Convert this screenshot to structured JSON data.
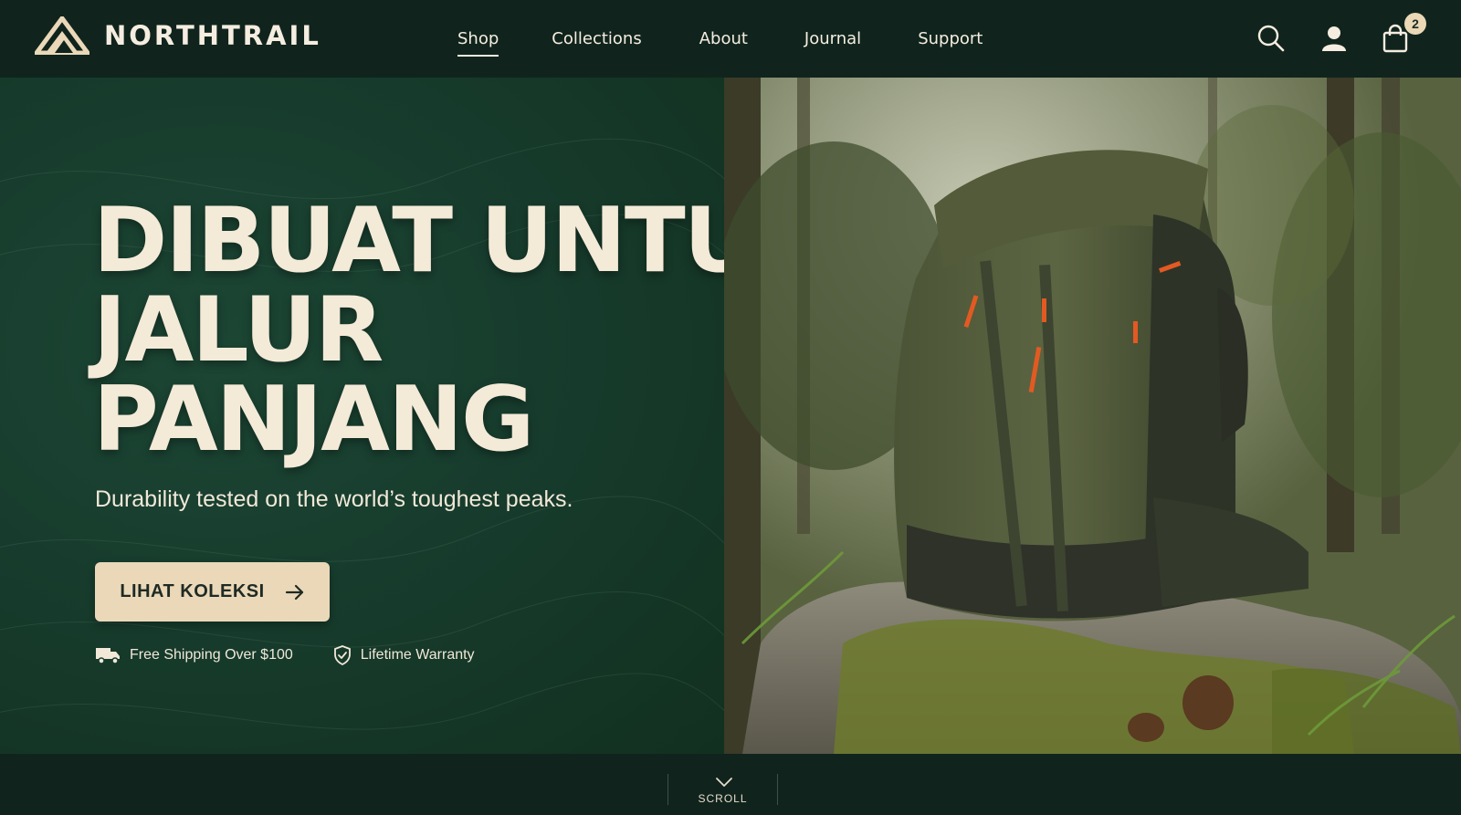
{
  "brand": {
    "name": "NORTHTRAIL",
    "logo_icon": "mountain-logo-icon"
  },
  "nav": {
    "items": [
      {
        "label": "Shop",
        "active": true
      },
      {
        "label": "Collections",
        "active": false
      },
      {
        "label": "About",
        "active": false
      },
      {
        "label": "Journal",
        "active": false
      },
      {
        "label": "Support",
        "active": false
      }
    ]
  },
  "header_icons": {
    "search": "search-icon",
    "account": "user-icon",
    "cart": "shopping-bag-icon",
    "cart_count": "2"
  },
  "hero": {
    "headline_lines": [
      "DIBUAT UNTUK",
      "JALUR",
      "PANJANG"
    ],
    "subtitle": "Durability tested on the world’s toughest peaks.",
    "cta_label": "LIHAT KOLEKSI",
    "cta_icon": "arrow-right-icon",
    "perks": [
      {
        "icon": "truck-icon",
        "label": "Free Shipping Over $100"
      },
      {
        "icon": "shield-check-icon",
        "label": "Lifetime Warranty"
      }
    ],
    "image_subject": "green hiking backpack on mossy rock in forest"
  },
  "scroll": {
    "label": "SCROLL",
    "icon": "chevron-down-icon"
  },
  "colors": {
    "header_bg": "#10241d",
    "hero_bg": "#173c2d",
    "cream": "#f4ead8",
    "cta_bg": "#ead8b8",
    "accent_orange": "#e25a22"
  }
}
